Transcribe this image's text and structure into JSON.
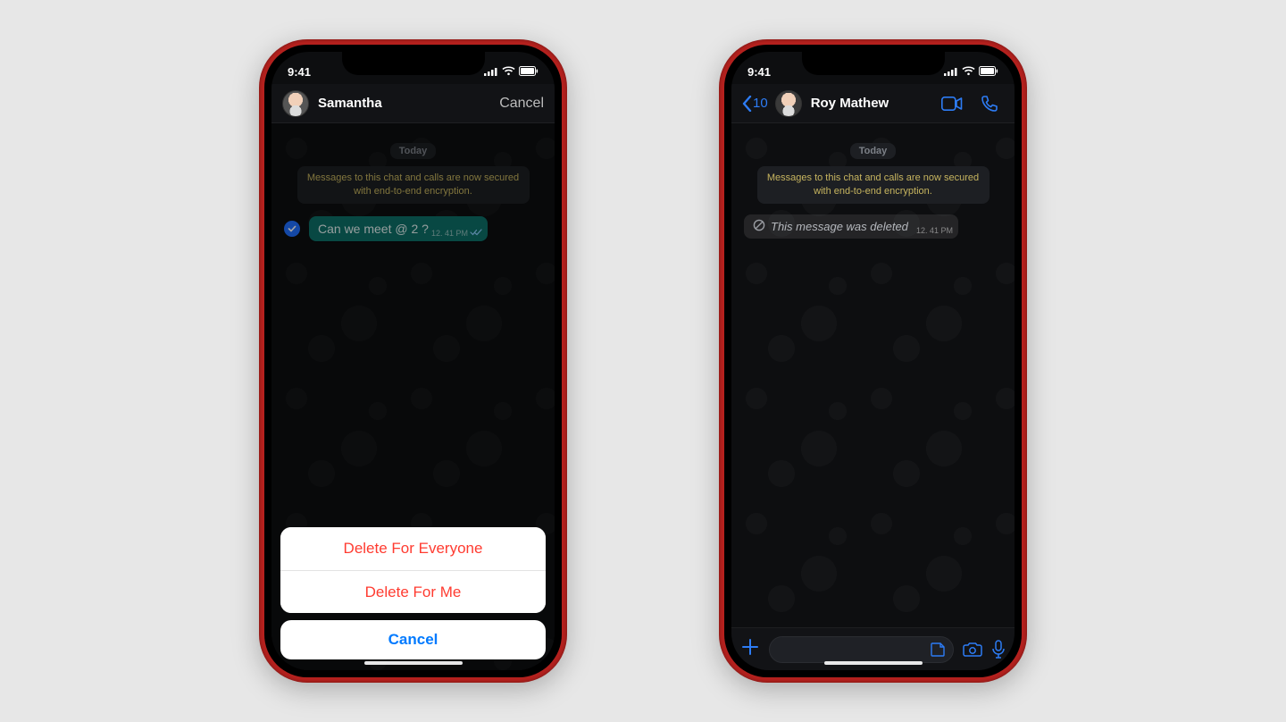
{
  "status": {
    "time": "9:41"
  },
  "left": {
    "header": {
      "name": "Samantha",
      "cancel": "Cancel"
    },
    "date_label": "Today",
    "encryption_note": "Messages to this chat and calls are now secured with end-to-end encryption.",
    "message": {
      "text": "Can we meet @ 2 ?",
      "time": "12. 41 PM"
    },
    "sheet": {
      "delete_everyone": "Delete  For Everyone",
      "delete_me": "Delete For Me",
      "cancel": "Cancel"
    }
  },
  "right": {
    "header": {
      "back_count": "10",
      "name": "Roy Mathew"
    },
    "date_label": "Today",
    "encryption_note": "Messages to this chat and calls are now secured with end-to-end encryption.",
    "deleted": {
      "text": "This message was deleted",
      "time": "12. 41 PM"
    }
  }
}
